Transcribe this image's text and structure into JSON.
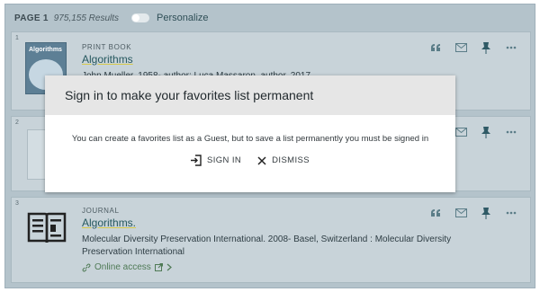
{
  "header": {
    "page_label": "PAGE 1",
    "results_count": "975,155 Results",
    "personalize_label": "Personalize"
  },
  "results": [
    {
      "number": "1",
      "type": "PRINT BOOK",
      "title": "Algorithms",
      "thumbnail_title": "Algorithms",
      "lines": [
        "John Mueller, 1958- author; Luca Massaron, author. 2017"
      ]
    },
    {
      "number": "2"
    },
    {
      "number": "3",
      "type": "JOURNAL",
      "title": "Algorithms.",
      "lines": [
        "Molecular Diversity Preservation International. 2008- Basel, Switzerland : Molecular Diversity",
        "Preservation International"
      ],
      "access_label": "Online access"
    }
  ],
  "modal": {
    "title": "Sign in to make your favorites list permanent",
    "message": "You can create a favorites list as a Guest, but to save a list permanently you must be signed in",
    "sign_in_label": "SIGN IN",
    "dismiss_label": "DISMISS"
  },
  "colors": {
    "link": "#26585f",
    "access": "#4f7a56",
    "pin": "#2f5a66",
    "overlay": "#b4c3cb"
  }
}
